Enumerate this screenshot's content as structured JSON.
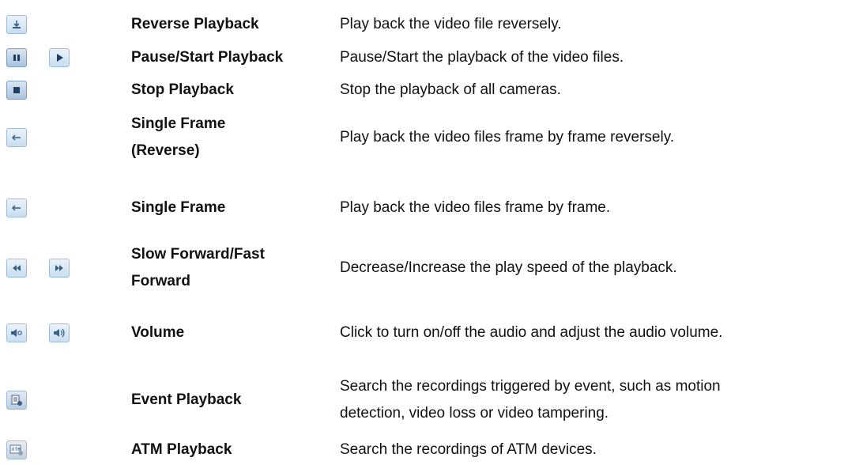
{
  "rows": [
    {
      "name": "Reverse Playback",
      "desc": "Play back the video file reversely.",
      "icons": [
        "reverse-playback-icon"
      ]
    },
    {
      "name": "Pause/Start Playback",
      "desc": "Pause/Start the playback of the video files.",
      "icons": [
        "pause-icon",
        "play-icon"
      ]
    },
    {
      "name": "Stop Playback",
      "desc": "Stop the playback of all cameras.",
      "icons": [
        "stop-icon"
      ]
    },
    {
      "name_lines": [
        "Single Frame",
        "(Reverse)"
      ],
      "desc": "Play back the video files frame by frame reversely.",
      "icons": [
        "single-frame-reverse-icon"
      ]
    },
    {
      "name": "Single Frame",
      "desc": "Play back the video files frame by frame.",
      "icons": [
        "single-frame-icon"
      ]
    },
    {
      "name_lines": [
        "Slow Forward/Fast",
        "Forward"
      ],
      "desc": "Decrease/Increase the play speed of the playback.",
      "icons": [
        "slow-forward-icon",
        "fast-forward-icon"
      ]
    },
    {
      "name": "Volume",
      "desc": "Click to turn on/off the audio and adjust the audio volume.",
      "icons": [
        "volume-off-icon",
        "volume-on-icon"
      ]
    },
    {
      "name": "Event Playback",
      "desc_lines": [
        "Search the recordings triggered by event, such as motion",
        "detection, video loss or video tampering."
      ],
      "icons": [
        "event-playback-icon"
      ]
    },
    {
      "name": "ATM Playback",
      "desc": "Search the recordings of ATM devices.",
      "icons": [
        "atm-playback-icon"
      ]
    }
  ]
}
